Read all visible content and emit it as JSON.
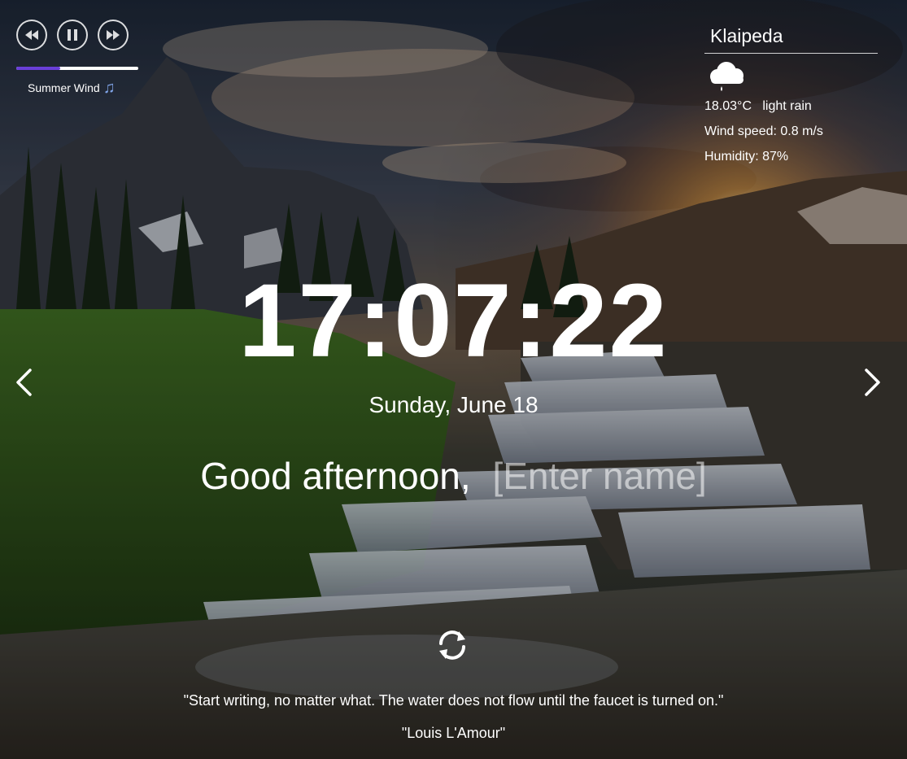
{
  "player": {
    "track_title": "Summer Wind",
    "progress_fraction": 0.36,
    "controls": [
      "rewind-icon",
      "pause-icon",
      "fast-forward-icon"
    ],
    "progress_color": "#6a3fd9",
    "note_icon": "music-note-icon"
  },
  "weather": {
    "city": "Klaipeda",
    "icon": "rain-cloud-icon",
    "temperature": "18.03°C",
    "description": "light rain",
    "wind": "Wind speed: 0.8 m/s",
    "humidity": "Humidity: 87%"
  },
  "clock": {
    "time": "17:07:22"
  },
  "date": "Sunday, June 18",
  "greeting": {
    "text": "Good afternoon,",
    "name_placeholder": "[Enter name]"
  },
  "quote": {
    "text": "\"Start writing, no matter what. The water does not flow until the faucet is turned on.\"",
    "author": "\"Louis L'Amour\""
  },
  "navigation": {
    "prev_icon": "chevron-left-icon",
    "next_icon": "chevron-right-icon",
    "refresh_icon": "refresh-icon"
  }
}
